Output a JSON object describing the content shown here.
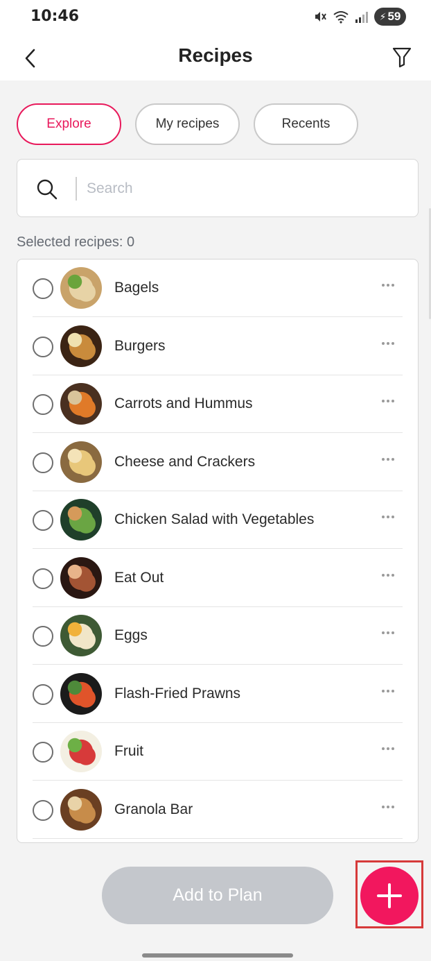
{
  "status_bar": {
    "time": "10:46",
    "battery": "59"
  },
  "header": {
    "title": "Recipes"
  },
  "tabs": [
    {
      "label": "Explore",
      "active": true
    },
    {
      "label": "My recipes",
      "active": false
    },
    {
      "label": "Recents",
      "active": false
    }
  ],
  "search": {
    "placeholder": "Search",
    "value": ""
  },
  "selected_label": "Selected recipes: 0",
  "recipes": [
    {
      "name": "Bagels",
      "thumb_colors": [
        "#c9a36a",
        "#e7d3a6",
        "#6aa43c"
      ]
    },
    {
      "name": "Burgers",
      "thumb_colors": [
        "#3b2414",
        "#c98b3c",
        "#efe1b0"
      ]
    },
    {
      "name": "Carrots and Hummus",
      "thumb_colors": [
        "#4a3020",
        "#e07a28",
        "#d9c49a"
      ]
    },
    {
      "name": "Cheese and Crackers",
      "thumb_colors": [
        "#8a6a40",
        "#e8c77a",
        "#f4e3b8"
      ]
    },
    {
      "name": "Chicken Salad with Vegetables",
      "thumb_colors": [
        "#1f3f2a",
        "#6aa543",
        "#d59a5a"
      ]
    },
    {
      "name": "Eat Out",
      "thumb_colors": [
        "#2a1712",
        "#a35434",
        "#e8b48a"
      ]
    },
    {
      "name": "Eggs",
      "thumb_colors": [
        "#3e5a34",
        "#f1e6c8",
        "#f1b23a"
      ]
    },
    {
      "name": "Flash-Fried Prawns",
      "thumb_colors": [
        "#1b1b1b",
        "#e0542a",
        "#4e8a3a"
      ]
    },
    {
      "name": "Fruit",
      "thumb_colors": [
        "#f3efe2",
        "#d73a3a",
        "#6db046"
      ]
    },
    {
      "name": "Granola Bar",
      "thumb_colors": [
        "#6a3f22",
        "#c78c4a",
        "#e9d3a8"
      ]
    }
  ],
  "buttons": {
    "add_to_plan": "Add to Plan"
  },
  "colors": {
    "accent": "#e8195b",
    "fab": "#f2175e",
    "disabled_button": "#c4c7cc",
    "highlight_box": "#d63a3a"
  },
  "icons": [
    "back-icon",
    "filter-icon",
    "search-icon",
    "more-icon",
    "plus-icon"
  ]
}
